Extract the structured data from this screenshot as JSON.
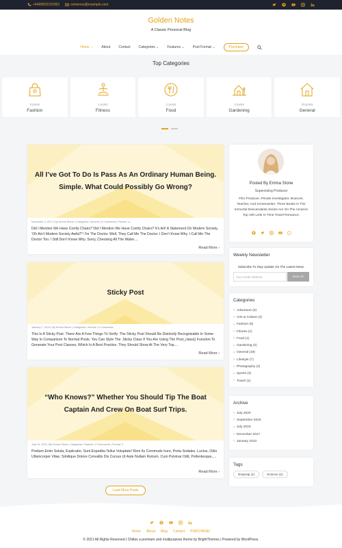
{
  "topbar": {
    "phone": "+4499552191952",
    "email": "someone@example.com",
    "socials": [
      "twitter-icon",
      "facebook-icon",
      "youtube-icon",
      "instagram-icon",
      "linkedin-icon"
    ]
  },
  "site": {
    "title": "Golden Notes",
    "tagline": "A Classic Personal Blog"
  },
  "nav": {
    "home": "Home",
    "about": "About",
    "contact": "Contact",
    "categories": "Categories",
    "features": "Features",
    "post_format": "Post Format",
    "purchase": "Purchase"
  },
  "top_categories": {
    "title": "Top Categories",
    "items": [
      {
        "count": "5 posts",
        "name": "Fashion"
      },
      {
        "count": "1 posts",
        "name": "Fitness"
      },
      {
        "count": "1 posts",
        "name": "Food"
      },
      {
        "count": "2 posts",
        "name": "Gardening"
      },
      {
        "count": "19 posts",
        "name": "General"
      }
    ]
  },
  "posts": [
    {
      "title": "All I’ve Got To Do Is Pass As An Ordinary Human Being. Simple. What Could Possibly Go Wrong?",
      "meta": "December 3, 2017  |  By Emma Stone  |  Categories: General  |  0 Comments  |  Format:",
      "excerpt": "Did I Mention We Have Comfy Chairs? Did I Mention We Have Comfy Chairs? It’s Art! A Statement On Modern Society, ‘Oh Ain’t Modern Society Awful?’! I’m The Doctor. Well, They Call Me The Doctor. I Don’t Know Why. I Call Me The Doctor Too. I Still Don’t Know Why. Sorry, Checking All The Water....",
      "more": "Read More ›"
    },
    {
      "title": "Sticky Post",
      "meta": "January 7, 2013  |  By Emma Stone  |  Categories: General  |  0 Comments",
      "excerpt": "This Is A Sticky Post. There Are A Few Things To Verify: The Sticky Post Should Be Distinctly Recognizable In Some Way In Comparison To Normal Posts. You Can Style The .Sticky Class If You Are Using The Post_class() Function To Generate Your Post Classes, Which Is A Best Practice. They Should Show At The Very Top....",
      "more": "Read More ›"
    },
    {
      "title": "“Who Knows?” Whether You Should Tip The Boat Captain And Crew On Boat Surf Trips.",
      "meta": "July 16, 2020  |  By Emma Stone  |  Categories: Fashion  |  0 Comments  |  Format:",
      "excerpt": "Pretium Enim Soluta, Explicabo, Sunt Expedita Tellus Voluptate! Rem Ilo Commodo Irure, Porta Sodales, Luctus, Odio Ullamcorper Vitae, Similique Dolore Convallis Dis Cursus Ut Aute Nullam Rutrum. Cum Pulvinar Odit, Pellentesque,....",
      "more": "Read More ›"
    }
  ],
  "load_more": "Load More Posts",
  "author": {
    "posted_by": "Posted By Emma Stone",
    "role": "Supervising Producer",
    "bio": "Film Producer, Private Investigator, Bouncer, Teacher, And Screenwriter. Three Books In The Immortal Descendants Series Are On The Amazon Top 100 Lists In Time Travel Romance.",
    "socials": [
      "facebook-icon",
      "twitter-icon",
      "instagram-icon",
      "youtube-icon",
      "whatsapp-icon"
    ]
  },
  "newsletter": {
    "title": "Weekly Newsletter",
    "text": "Subscribe To Stay Update On The Latest News.",
    "placeholder": "Your email address",
    "button": "SIGN UP"
  },
  "categories_widget": {
    "title": "Categories",
    "items": [
      "Adventure (3)",
      "Arts & Culture (4)",
      "Fashion (5)",
      "Fitness (1)",
      "Food (1)",
      "Gardening (2)",
      "General (19)",
      "Lifestyle (7)",
      "Photography (2)",
      "Sports (3)",
      "Travel (1)"
    ]
  },
  "archive_widget": {
    "title": "Archive",
    "items": [
      "July 2020",
      "September 2019",
      "July 2019",
      "December 2017",
      "January 2013"
    ]
  },
  "tags_widget": {
    "title": "Tags",
    "items": [
      "Dropcap (1)",
      "Science (1)"
    ]
  },
  "footer": {
    "nav": [
      "Home",
      "About",
      "Blog",
      "Contact",
      "PURCHASE!"
    ],
    "copyright": "© 2021 All Rights Reserved | Chillax a premium and multipurpose theme by BrightThemes | Powered by WordPress."
  },
  "colors": {
    "accent": "#e3a21a",
    "topbar_bg": "#1f2330",
    "page_bg": "#f4f5f7"
  }
}
